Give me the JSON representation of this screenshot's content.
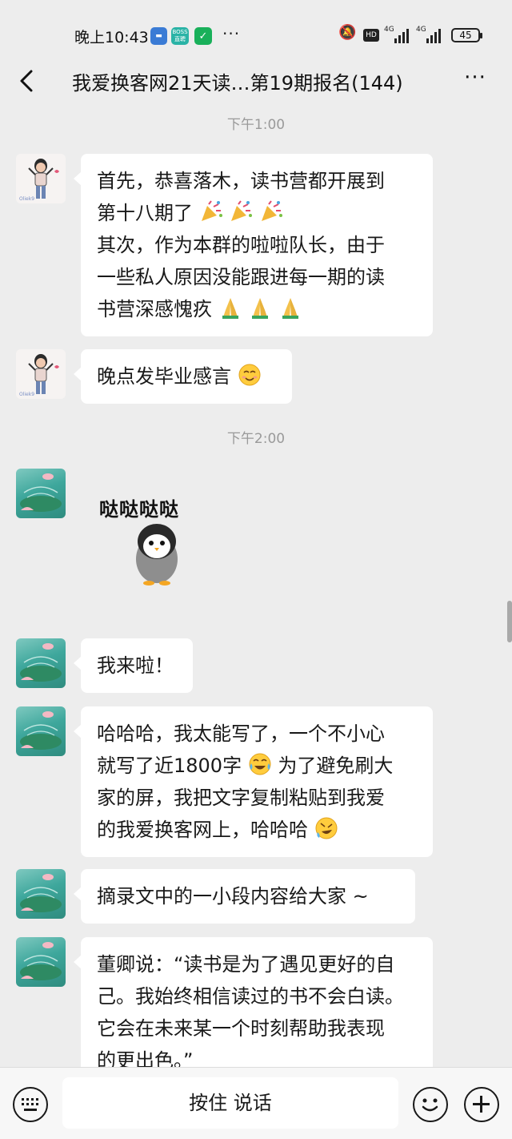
{
  "status": {
    "time": "晚上10:43",
    "boss_label": "BOSS直聘",
    "network_1": "4G",
    "network_2": "4G",
    "hd_label": "HD",
    "battery": "45"
  },
  "header": {
    "title": "我爱换客网21天读…第19期报名(144)"
  },
  "chat": {
    "time_1": "下午1:00",
    "time_2": "下午2:00",
    "msg_1": {
      "line_1": "首先，恭喜落木，读书营都开展到",
      "line_2": "第十八期了",
      "line_3": "其次，作为本群的啦啦队长，由于",
      "line_4": "一些私人原因没能跟进每一期的读",
      "line_5": "书营深感愧疚"
    },
    "msg_2": "晚点发毕业感言",
    "sticker_text": "哒哒哒哒",
    "msg_3": "我来啦！",
    "msg_4": {
      "line_1": "哈哈哈，我太能写了，一个不小心",
      "line_2a": "就写了近1800字",
      "line_2b": " 为了避免刷大",
      "line_3": "家的屏，我把文字复制粘贴到我爱",
      "line_4": "的我爱换客网上，哈哈哈"
    },
    "msg_5": "摘录文中的一小段内容给大家 ~",
    "msg_6": {
      "line_1": "董卿说：“读书是为了遇见更好的自",
      "line_2": "己。我始终相信读过的书不会白读。",
      "line_3": "它会在未来某一个时刻帮助我表现",
      "line_4": "的更出色。”"
    }
  },
  "input": {
    "talk_label": "按住 说话"
  },
  "icons": {
    "party": "party-popper-icon",
    "pray": "folded-hands-icon",
    "smile": "smiling-face-icon",
    "laugh": "tears-of-joy-icon"
  }
}
